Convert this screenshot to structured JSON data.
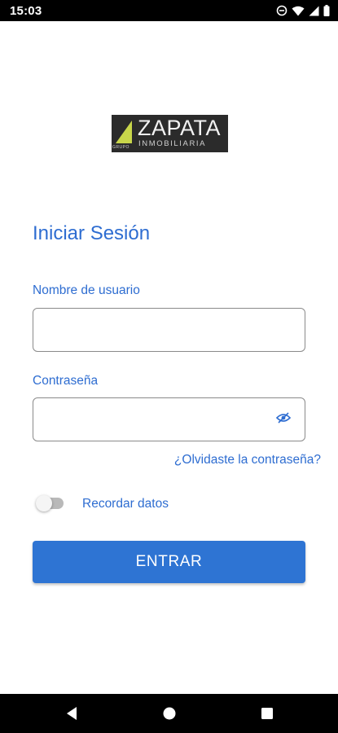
{
  "status_bar": {
    "time": "15:03",
    "icons": [
      "do-not-disturb-icon",
      "wifi-icon",
      "signal-icon",
      "battery-icon"
    ]
  },
  "logo": {
    "name": "ZAPATA",
    "subtitle": "INMOBILIARIA",
    "small_text": "GRUPO"
  },
  "login": {
    "title": "Iniciar Sesión",
    "username_label": "Nombre de usuario",
    "username_value": "",
    "password_label": "Contraseña",
    "password_value": "",
    "forgot_link": "¿Olvidaste la contraseña?",
    "remember_label": "Recordar datos",
    "remember_enabled": false,
    "submit_label": "ENTRAR"
  },
  "nav_bar": {
    "buttons": [
      "back-icon",
      "home-icon",
      "recents-icon"
    ]
  },
  "colors": {
    "accent": "#2e6dd1",
    "button": "#2e74d3",
    "logo_background": "#2b2b2b",
    "logo_mark": "#c8d64a"
  }
}
